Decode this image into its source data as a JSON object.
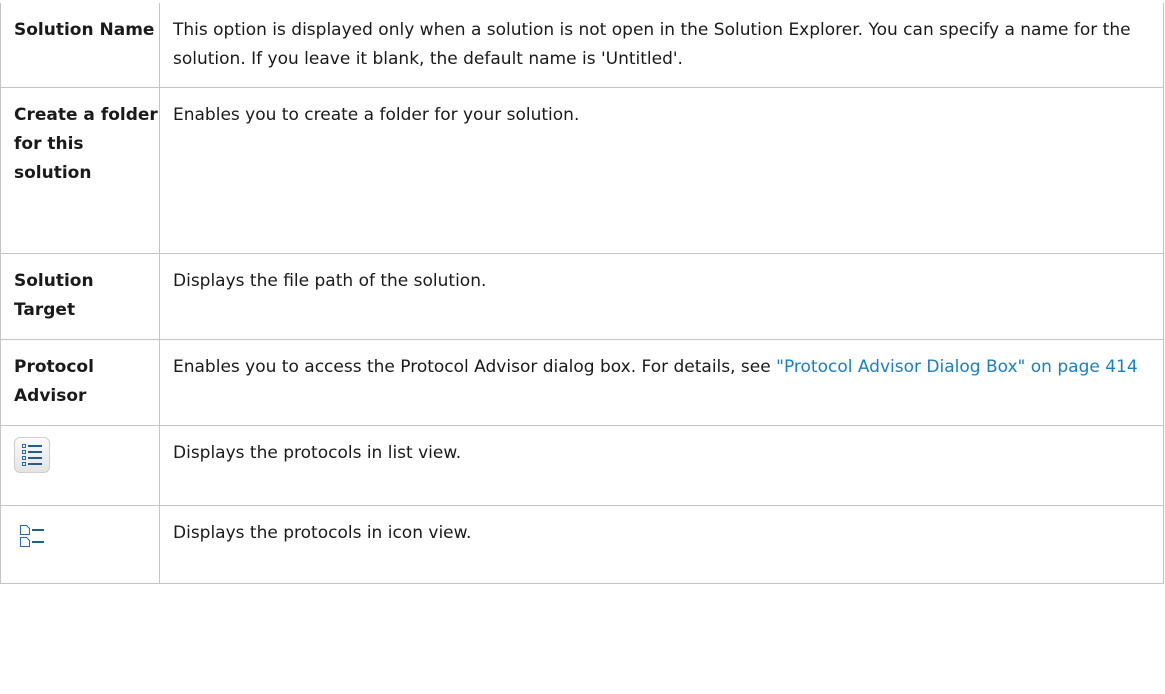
{
  "rows": [
    {
      "label": "Solution Name",
      "description": "This option is displayed only when a solution is not open in the Solution Explorer. You can specify a name for the solution. If you leave it blank, the default name is 'Untitled'."
    },
    {
      "label": "Create a folder for this solution",
      "description": "Enables you to create a folder for your solution."
    },
    {
      "label": "Solution Target",
      "description": "Displays the file path of the solution."
    },
    {
      "label": "Protocol Advisor",
      "description": "Enables you to access the Protocol Advisor dialog box. For details, see ",
      "link_text": "\"Protocol Advisor Dialog Box\" on page 414"
    },
    {
      "icon": "list-view-icon",
      "description": "Displays the protocols in list view."
    },
    {
      "icon": "icon-view-icon",
      "description": "Displays the protocols in icon view."
    }
  ],
  "colors": {
    "link": "#1a7fc2",
    "border": "#c4c4c4",
    "icon_blue": "#1f5d96"
  }
}
